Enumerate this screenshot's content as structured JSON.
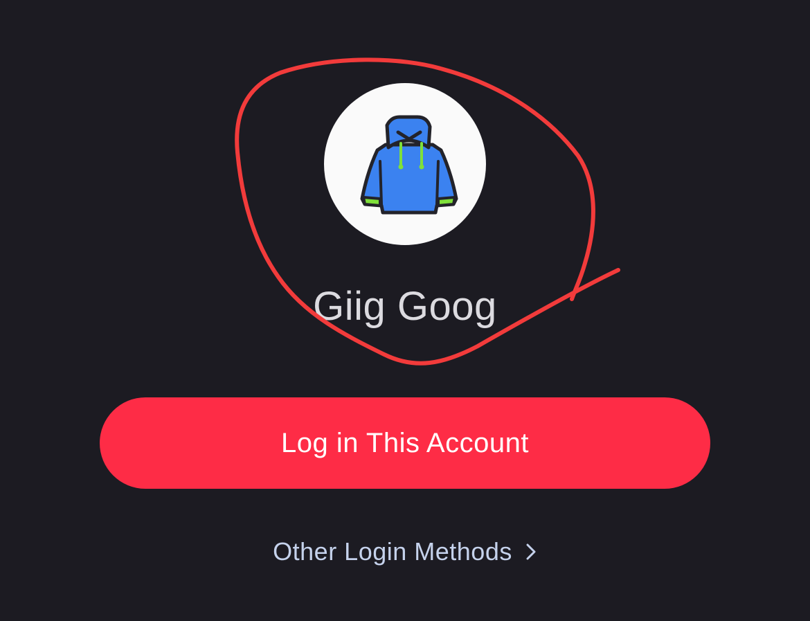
{
  "profile": {
    "avatar_icon": "hoodie-icon",
    "display_name": "Giig Goog"
  },
  "actions": {
    "login_label": "Log in This Account",
    "other_methods_label": "Other Login Methods",
    "other_methods_icon": "chevron-right-icon"
  },
  "colors": {
    "background": "#1c1b22",
    "primary_button": "#fe2c46",
    "annotation_stroke": "#f23b3b",
    "link_text": "#c5d2ec",
    "hoodie_body": "#3b82f0",
    "hoodie_accent": "#7fe03a"
  }
}
